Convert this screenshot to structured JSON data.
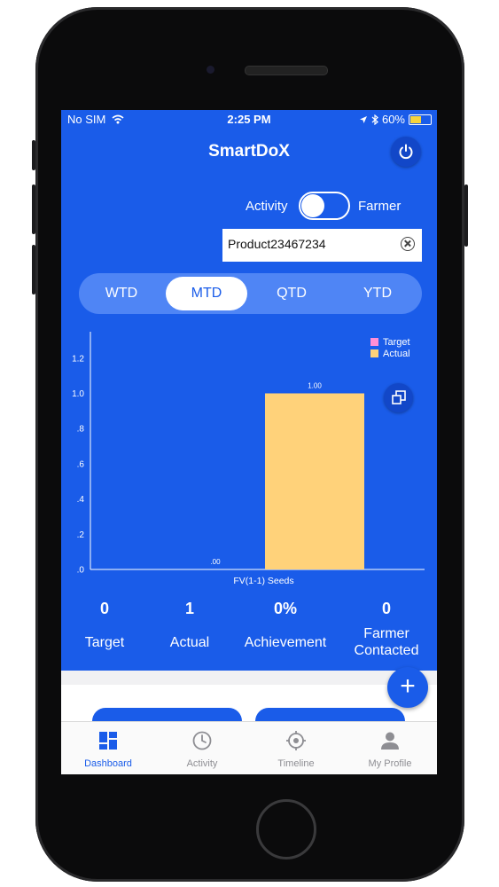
{
  "status_bar": {
    "carrier": "No SIM",
    "time": "2:25 PM",
    "battery": "60%",
    "battery_level": 0.6
  },
  "header": {
    "title": "SmartDoX",
    "power_icon": "power-icon"
  },
  "toggle": {
    "left_label": "Activity",
    "right_label": "Farmer",
    "state": "Activity"
  },
  "search": {
    "value": "Product23467234",
    "clear_icon": "clear-circle-icon"
  },
  "periods": {
    "items": [
      "WTD",
      "MTD",
      "QTD",
      "YTD"
    ],
    "selected": "MTD"
  },
  "chart_data": {
    "type": "bar",
    "categories": [
      "FV(1-1) Seeds"
    ],
    "series": [
      {
        "name": "Target",
        "values": [
          0
        ],
        "color": "#ff8fd6"
      },
      {
        "name": "Actual",
        "values": [
          1.0
        ],
        "color": "#ffd27a"
      }
    ],
    "data_labels": [
      ".00",
      "1.00"
    ],
    "yticks": [
      ".0",
      ".2",
      ".4",
      ".6",
      ".8",
      "1.0",
      "1.2"
    ],
    "ylim": [
      0,
      1.35
    ],
    "legend": "top-right",
    "grid": false
  },
  "stats": [
    {
      "value": "0",
      "label": "Target"
    },
    {
      "value": "1",
      "label": "Actual"
    },
    {
      "value": "0%",
      "label": "Achievement"
    },
    {
      "value": "0",
      "label": "Farmer Contacted"
    }
  ],
  "fab_label": "+",
  "tabs": [
    {
      "label": "Dashboard",
      "icon": "dashboard-icon",
      "active": true
    },
    {
      "label": "Activity",
      "icon": "clock-icon",
      "active": false
    },
    {
      "label": "Timeline",
      "icon": "target-icon",
      "active": false
    },
    {
      "label": "My Profile",
      "icon": "person-icon",
      "active": false
    }
  ],
  "colors": {
    "primary": "#1a5ce9",
    "segment_bg": "#4f85f5",
    "actual_bar": "#ffd27a",
    "target_legend": "#ff8fd6"
  }
}
